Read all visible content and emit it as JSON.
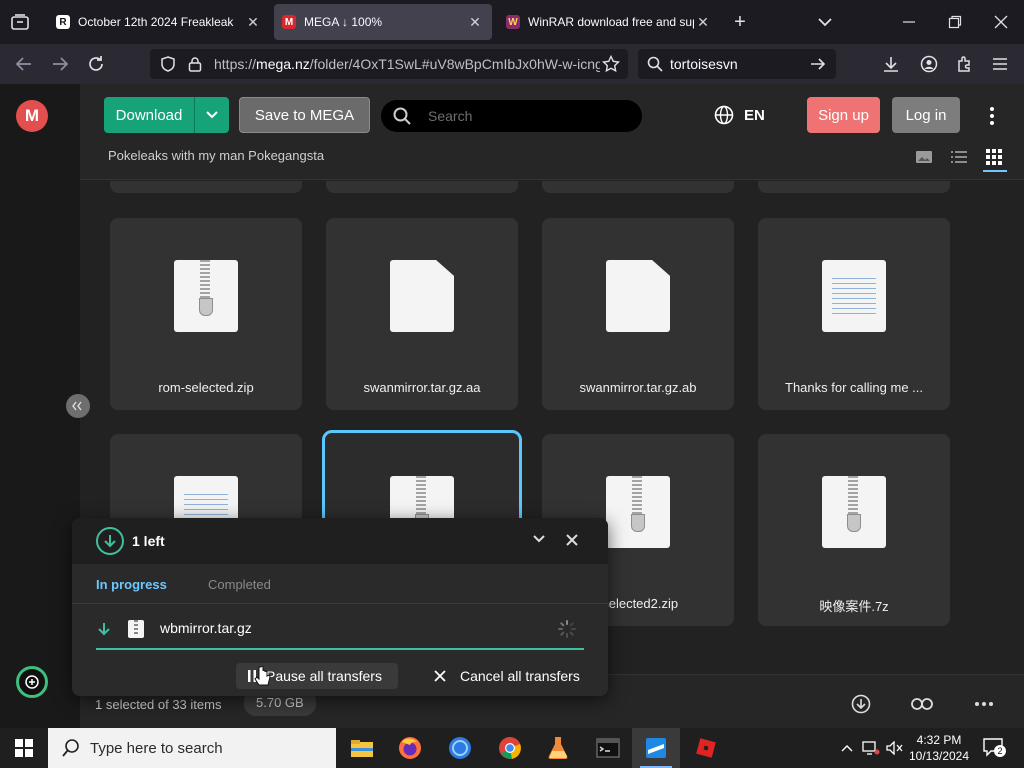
{
  "browser": {
    "tabs": [
      {
        "label": "October 12th 2024 Freakleak",
        "favicon": "R",
        "active": false
      },
      {
        "label": "MEGA ↓ 100%",
        "favicon": "M",
        "active": true
      },
      {
        "label": "WinRAR download free and sup",
        "favicon": "W",
        "active": false
      }
    ],
    "url_prefix": "https://",
    "url_host": "mega.nz",
    "url_path": "/folder/4OxT1SwL#uV8wBpCmIbJx0hW-w-icng",
    "search_text": "tortoisesvn"
  },
  "mega": {
    "download_label": "Download",
    "save_label": "Save to MEGA",
    "search_placeholder": "Search",
    "language": "EN",
    "signup_label": "Sign up",
    "login_label": "Log in",
    "folder_title": "Pokeleaks with my man Pokegangsta"
  },
  "files": [
    {
      "name": "rom-selected.zip",
      "type": "zip"
    },
    {
      "name": "swanmirror.tar.gz.aa",
      "type": "blank"
    },
    {
      "name": "swanmirror.tar.gz.ab",
      "type": "blank"
    },
    {
      "name": "Thanks for calling me ...",
      "type": "text"
    },
    {
      "name": "",
      "type": "text"
    },
    {
      "name": "",
      "type": "zip",
      "selected": true
    },
    {
      "name": "-selected2.zip",
      "type": "zip"
    },
    {
      "name": "映像案件.7z",
      "type": "zip"
    }
  ],
  "transfers": {
    "left_label": "1 left",
    "tab_in_progress": "In progress",
    "tab_completed": "Completed",
    "current_file": "wbmirror.tar.gz",
    "pause_label": "Pause all transfers",
    "cancel_label": "Cancel all transfers"
  },
  "status": {
    "selection": "1 selected of 33 items",
    "size": "5.70 GB"
  },
  "taskbar": {
    "search_placeholder": "Type here to search",
    "time": "4:32 PM",
    "date": "10/13/2024",
    "notifications": "2"
  },
  "colors": {
    "accent_green": "#16a37a",
    "signup_red": "#f07373",
    "selection_blue": "#5ac8ff"
  }
}
